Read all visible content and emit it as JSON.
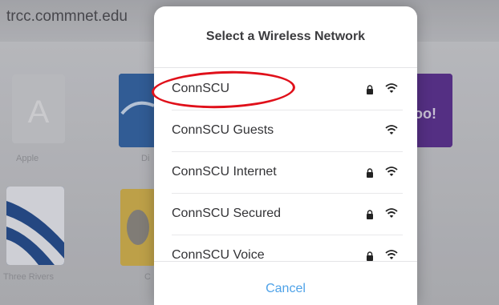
{
  "address_bar": {
    "url": "trcc.commnet.edu"
  },
  "favorites": [
    {
      "label": "Apple"
    },
    {
      "label": "Di"
    },
    {
      "label": "Three Rivers"
    },
    {
      "label": "C"
    }
  ],
  "popover": {
    "title": "Select a Wireless Network",
    "networks": [
      {
        "name": "ConnSCU",
        "secured": true
      },
      {
        "name": "ConnSCU Guests",
        "secured": false
      },
      {
        "name": "ConnSCU Internet",
        "secured": true
      },
      {
        "name": "ConnSCU Secured",
        "secured": true
      },
      {
        "name": "ConnSCU Voice",
        "secured": true
      }
    ],
    "cancel_label": "Cancel"
  },
  "colors": {
    "accent": "#4ea2e8",
    "highlight": "#e0101a"
  }
}
